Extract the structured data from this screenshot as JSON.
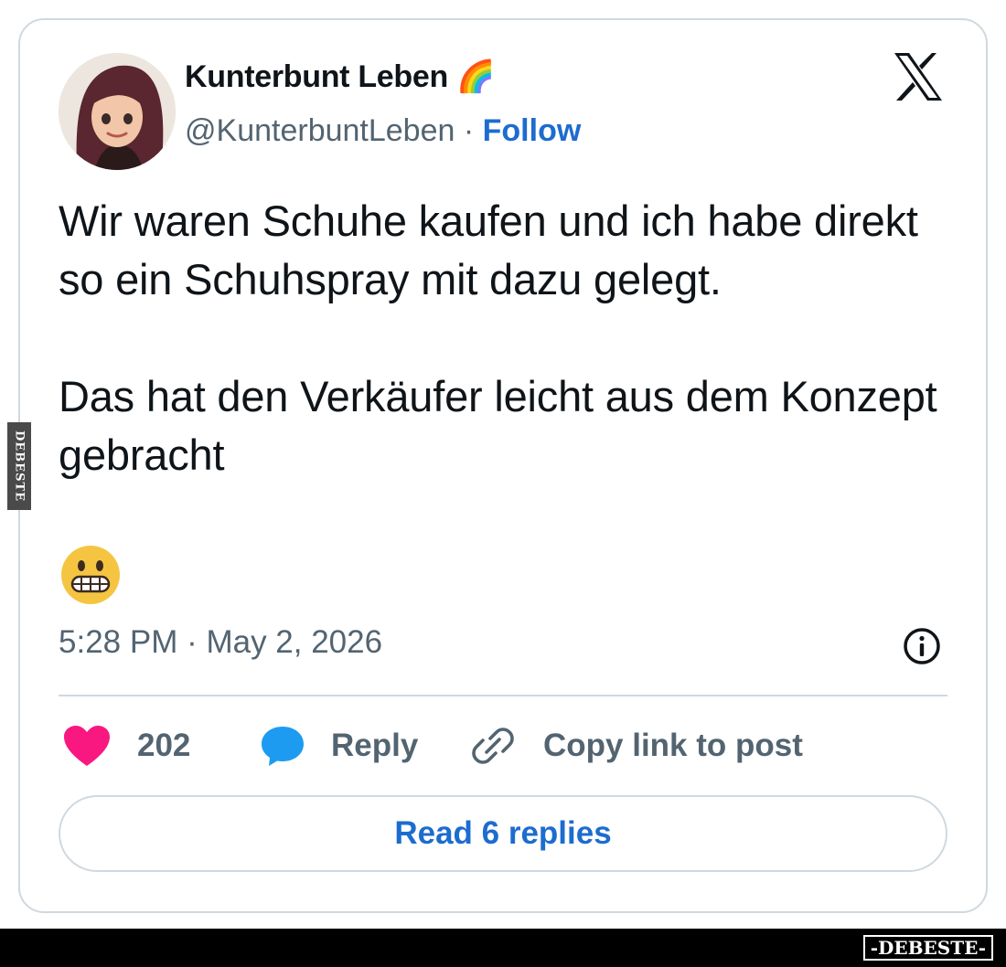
{
  "post": {
    "author": {
      "display_name": "Kunterbunt Leben 🌈",
      "handle": "@KunterbuntLeben",
      "separator": " · ",
      "follow_label": "Follow"
    },
    "text": "Wir waren Schuhe kaufen und ich habe direkt so ein Schuhspray mit dazu gelegt.\n\nDas hat den Verkäufer leicht aus dem Konzept gebracht",
    "emoji": "grimacing-face-emoji",
    "timestamp": "5:28 PM · May 2, 2026",
    "actions": {
      "like_count": "202",
      "reply_label": "Reply",
      "copy_link_label": "Copy link to post"
    },
    "read_replies_label": "Read 6 replies"
  },
  "icons": {
    "platform_logo": "x-logo-icon",
    "like": "heart-icon",
    "reply": "speech-bubble-icon",
    "copy_link": "link-icon",
    "info": "info-icon"
  },
  "colors": {
    "link_blue": "#1d6ccf",
    "like_pink": "#f91880",
    "reply_blue": "#1d9bf0",
    "muted_text": "#536471",
    "border": "#cfd9de"
  },
  "watermarks": {
    "side": "DEBESTE",
    "bottom": "-DEBESTE-"
  }
}
